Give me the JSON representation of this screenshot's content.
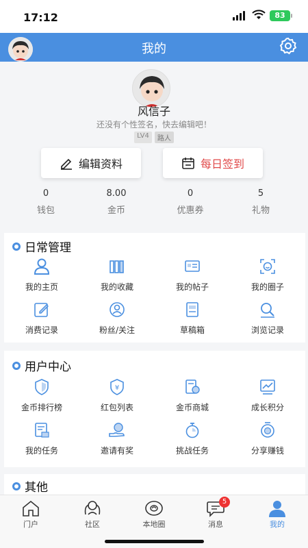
{
  "status_bar": {
    "time": "17:12",
    "battery": "83"
  },
  "header": {
    "title": "我的"
  },
  "profile": {
    "username": "风信子",
    "bio": "还没有个性签名，快去编辑吧！",
    "level": "LV4",
    "rank": "路人"
  },
  "actions": {
    "edit_label": "编辑资料",
    "signin_label": "每日签到"
  },
  "stats": [
    {
      "value": "0",
      "label": "钱包"
    },
    {
      "value": "8.00",
      "label": "金币"
    },
    {
      "value": "0",
      "label": "优惠券"
    },
    {
      "value": "5",
      "label": "礼物"
    }
  ],
  "daily": {
    "title": "日常管理",
    "items": [
      {
        "label": "我的主页",
        "icon": "user-icon"
      },
      {
        "label": "我的收藏",
        "icon": "books-icon"
      },
      {
        "label": "我的帖子",
        "icon": "post-icon"
      },
      {
        "label": "我的圈子",
        "icon": "circle-face-icon"
      },
      {
        "label": "消费记录",
        "icon": "edit-note-icon"
      },
      {
        "label": "粉丝/关注",
        "icon": "fans-icon"
      },
      {
        "label": "草稿箱",
        "icon": "draft-icon"
      },
      {
        "label": "浏览记录",
        "icon": "browse-icon"
      }
    ]
  },
  "user_center": {
    "title": "用户中心",
    "items": [
      {
        "label": "金币排行榜",
        "icon": "shield-rank-icon"
      },
      {
        "label": "红包列表",
        "icon": "red-packet-icon"
      },
      {
        "label": "金币商城",
        "icon": "shop-icon"
      },
      {
        "label": "成长积分",
        "icon": "growth-icon"
      },
      {
        "label": "我的任务",
        "icon": "task-icon"
      },
      {
        "label": "邀请有奖",
        "icon": "invite-icon"
      },
      {
        "label": "挑战任务",
        "icon": "stopwatch-icon"
      },
      {
        "label": "分享赚钱",
        "icon": "share-coin-icon"
      }
    ]
  },
  "other": {
    "title": "其他"
  },
  "tabbar": {
    "items": [
      {
        "label": "门户",
        "icon": "home-icon"
      },
      {
        "label": "社区",
        "icon": "community-icon"
      },
      {
        "label": "本地圈",
        "icon": "local-icon"
      },
      {
        "label": "消息",
        "icon": "message-icon",
        "badge": "5"
      },
      {
        "label": "我的",
        "icon": "me-icon"
      }
    ]
  },
  "colors": {
    "accent": "#4a8fe0",
    "sign_red": "#e04848",
    "badge_red": "#e33333"
  }
}
